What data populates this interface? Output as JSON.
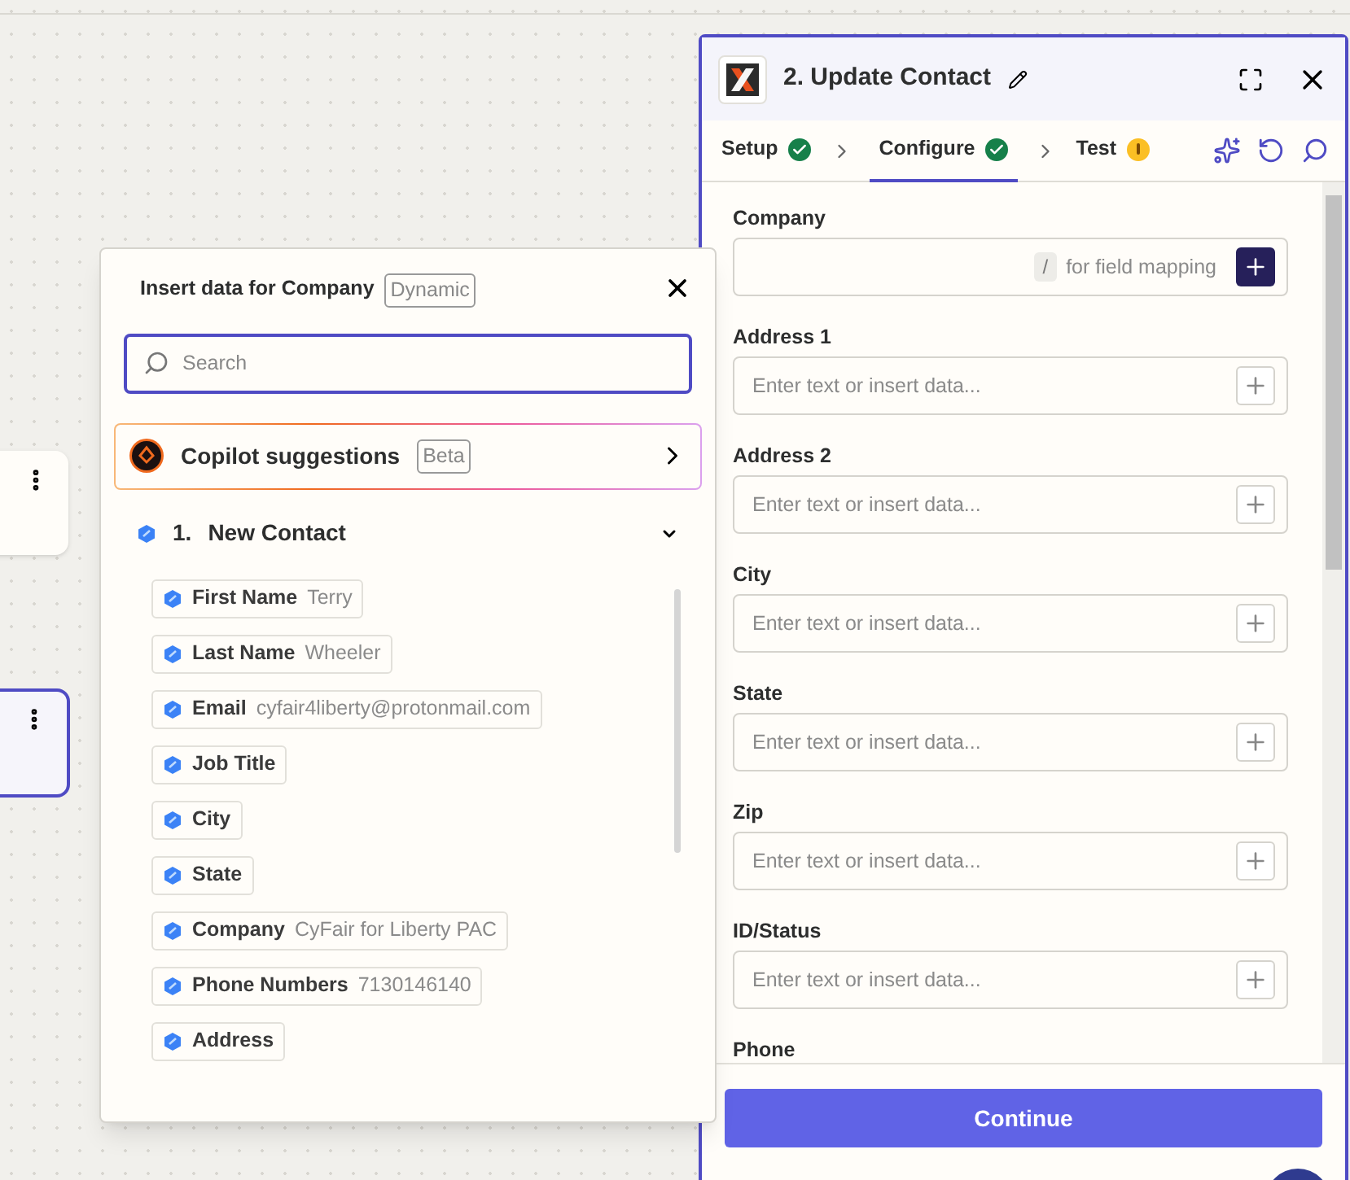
{
  "panel": {
    "title": "2. Update Contact",
    "tabs": [
      {
        "label": "Setup",
        "selected": false,
        "kind": "done"
      },
      {
        "label": "Configure",
        "selected": true,
        "kind": "done"
      },
      {
        "label": "Test",
        "selected": false,
        "kind": "warning"
      }
    ],
    "fields": [
      {
        "label": "Company",
        "kind": "mapping",
        "key_hint": "/",
        "hint": "for field mapping"
      },
      {
        "label": "Address 1",
        "kind": "text",
        "placeholder": "Enter text or insert data..."
      },
      {
        "label": "Address 2",
        "kind": "text",
        "placeholder": "Enter text or insert data..."
      },
      {
        "label": "City",
        "kind": "text",
        "placeholder": "Enter text or insert data..."
      },
      {
        "label": "State",
        "kind": "text",
        "placeholder": "Enter text or insert data..."
      },
      {
        "label": "Zip",
        "kind": "text",
        "placeholder": "Enter text or insert data..."
      },
      {
        "label": "ID/Status",
        "kind": "text",
        "placeholder": "Enter text or insert data..."
      },
      {
        "label": "Phone",
        "kind": "label"
      }
    ],
    "continue_button": "Continue"
  },
  "popover": {
    "title": "Insert data for Company",
    "badge": "Dynamic",
    "search": {
      "placeholder": "Search"
    },
    "copilot": {
      "label": "Copilot suggestions",
      "badge": "Beta"
    },
    "step": {
      "number": "1.",
      "name": "New Contact",
      "expanded": true
    },
    "items": [
      {
        "label": "First Name",
        "value": "Terry"
      },
      {
        "label": "Last Name",
        "value": "Wheeler"
      },
      {
        "label": "Email",
        "value": "cyfair4liberty@protonmail.com"
      },
      {
        "label": "Job Title"
      },
      {
        "label": "City"
      },
      {
        "label": "State"
      },
      {
        "label": "Company",
        "value": "CyFair for Liberty PAC"
      },
      {
        "label": "Phone Numbers",
        "value": "7130146140"
      },
      {
        "label": "Address"
      }
    ]
  }
}
